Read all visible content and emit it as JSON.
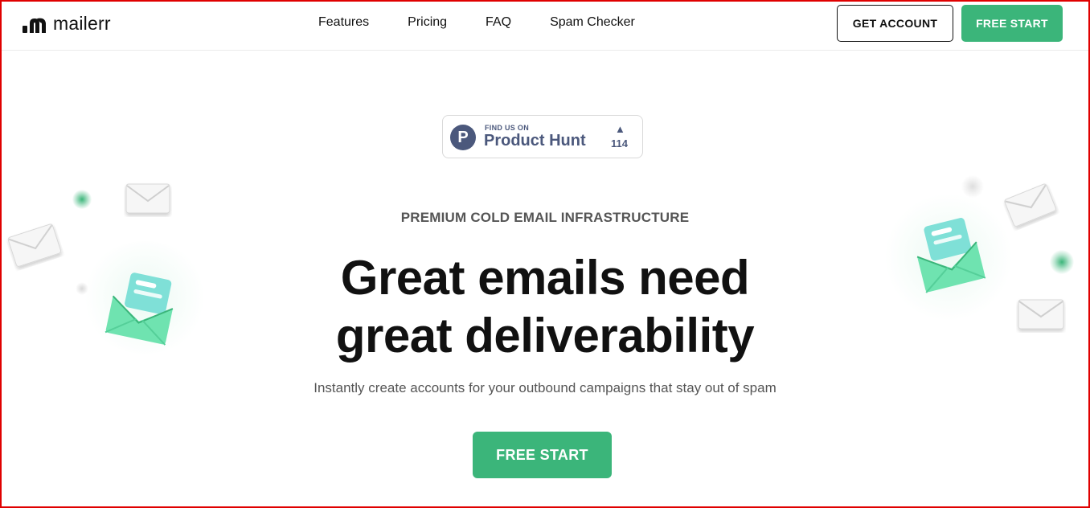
{
  "brand": {
    "name": "mailerr",
    "logo_icon": "mailerr-logo-icon"
  },
  "nav": {
    "items": [
      {
        "label": "Features"
      },
      {
        "label": "Pricing"
      },
      {
        "label": "FAQ"
      },
      {
        "label": "Spam Checker"
      }
    ]
  },
  "header": {
    "get_account_label": "GET ACCOUNT",
    "free_start_label": "FREE START"
  },
  "product_hunt": {
    "find_label": "FIND US ON",
    "name": "Product Hunt",
    "logo_letter": "P",
    "upvote_icon": "▲",
    "upvote_count": "114",
    "color": "#4b587c"
  },
  "hero": {
    "eyebrow": "PREMIUM COLD EMAIL INFRASTRUCTURE",
    "headline_line1": "Great emails need",
    "headline_line2": "great deliverability",
    "subline": "Instantly create accounts for your outbound campaigns that stay out of spam",
    "cta_label": "FREE START"
  },
  "colors": {
    "accent": "#3bb57a",
    "text": "#111111",
    "muted": "#555555",
    "frame": "#e00000"
  }
}
